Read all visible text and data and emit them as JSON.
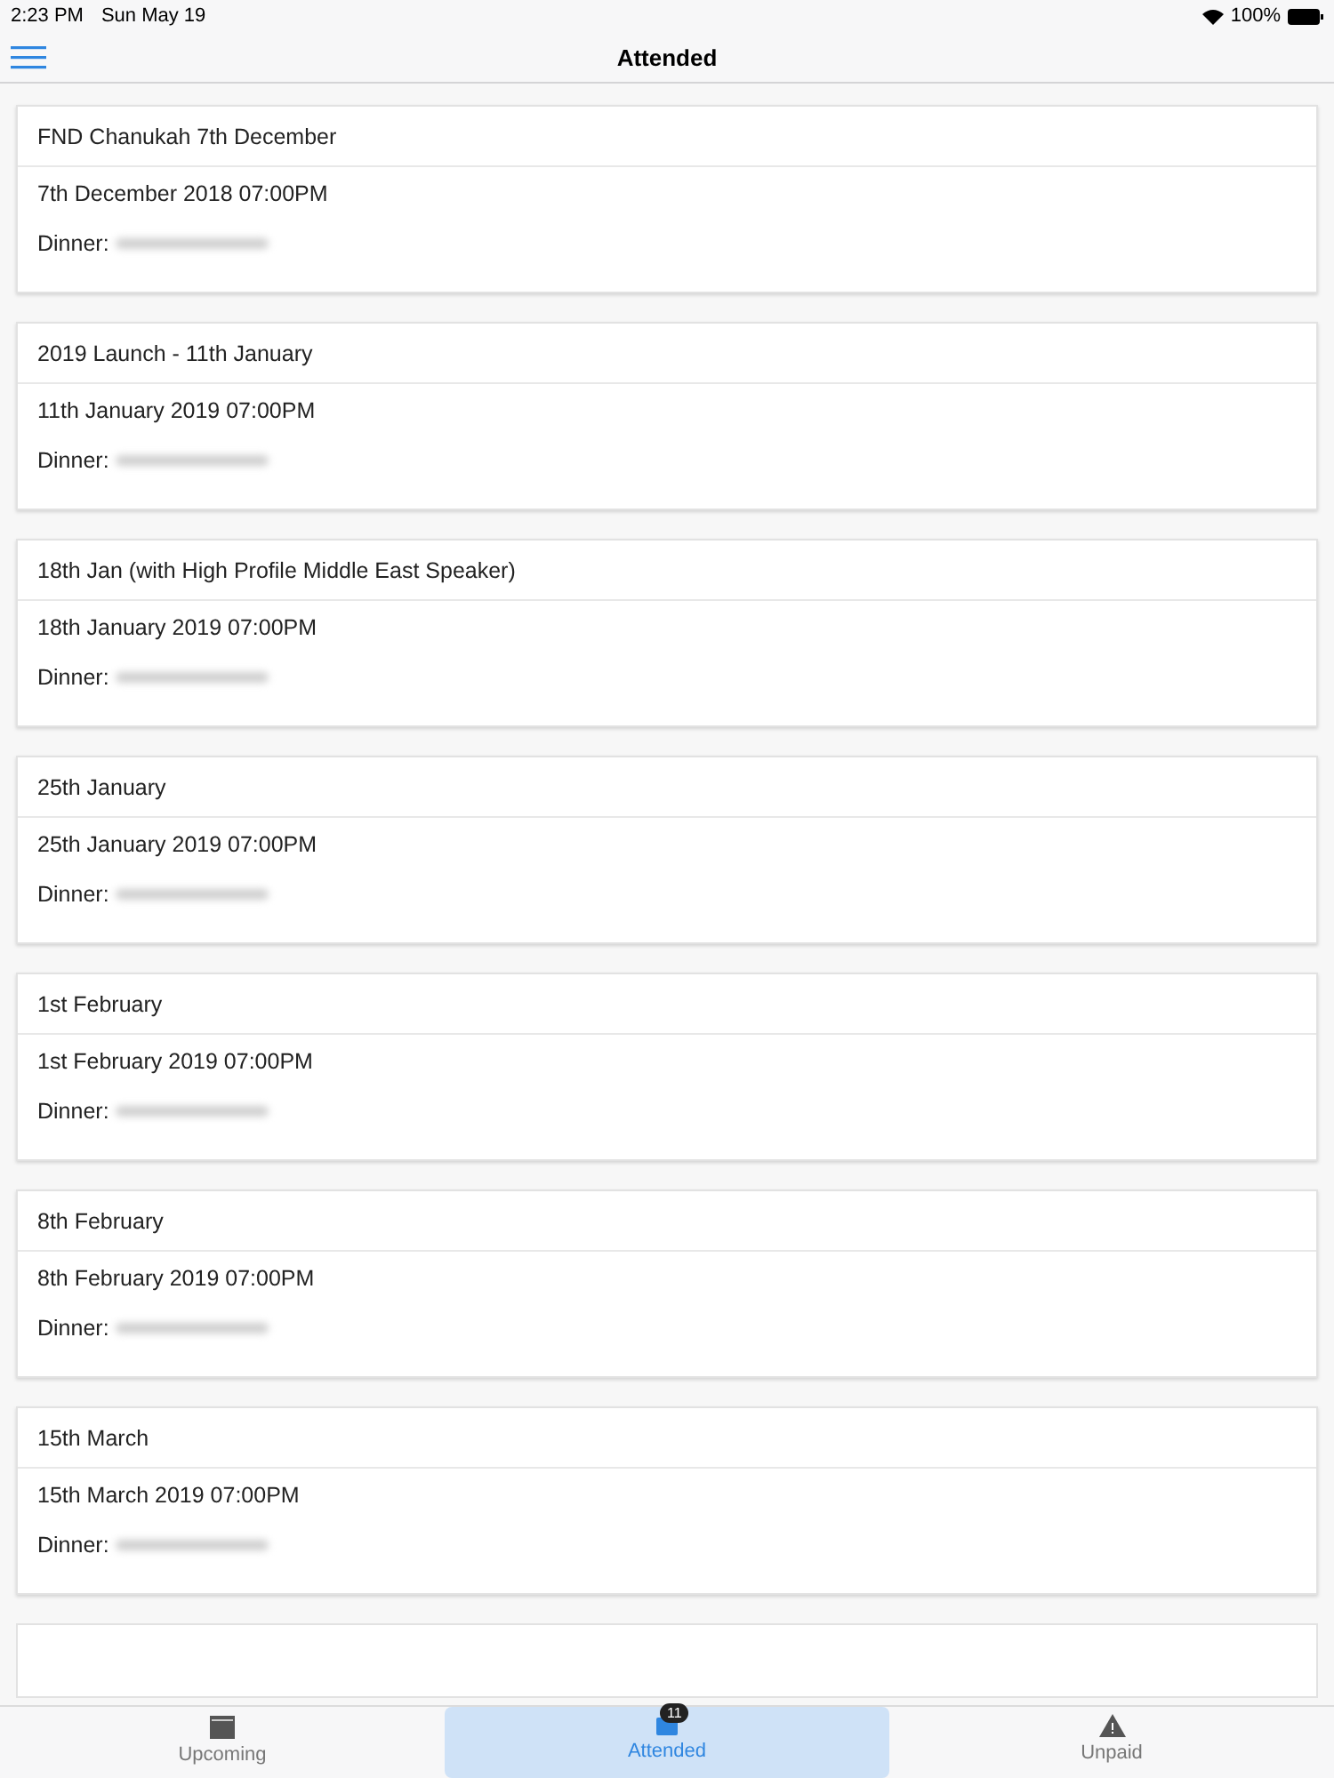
{
  "status_bar": {
    "time": "2:23 PM",
    "date": "Sun May 19",
    "battery": "100%"
  },
  "nav": {
    "title": "Attended"
  },
  "events": [
    {
      "title": "FND Chanukah 7th December",
      "datetime": "7th December 2018 07:00PM",
      "dinner_label": "Dinner:"
    },
    {
      "title": "2019 Launch - 11th January",
      "datetime": "11th January 2019 07:00PM",
      "dinner_label": "Dinner:"
    },
    {
      "title": "18th Jan (with High Profile Middle East Speaker)",
      "datetime": "18th January 2019 07:00PM",
      "dinner_label": "Dinner:"
    },
    {
      "title": "25th January",
      "datetime": "25th January 2019 07:00PM",
      "dinner_label": "Dinner:"
    },
    {
      "title": "1st February",
      "datetime": "1st February 2019 07:00PM",
      "dinner_label": "Dinner:"
    },
    {
      "title": "8th February",
      "datetime": "8th February 2019 07:00PM",
      "dinner_label": "Dinner:"
    },
    {
      "title": "15th March",
      "datetime": "15th March 2019 07:00PM",
      "dinner_label": "Dinner:"
    }
  ],
  "tabs": [
    {
      "label": "Upcoming",
      "kind": "calendar",
      "selected": false
    },
    {
      "label": "Attended",
      "kind": "inbox",
      "selected": true,
      "badge": "11"
    },
    {
      "label": "Unpaid",
      "kind": "warning",
      "selected": false
    }
  ]
}
